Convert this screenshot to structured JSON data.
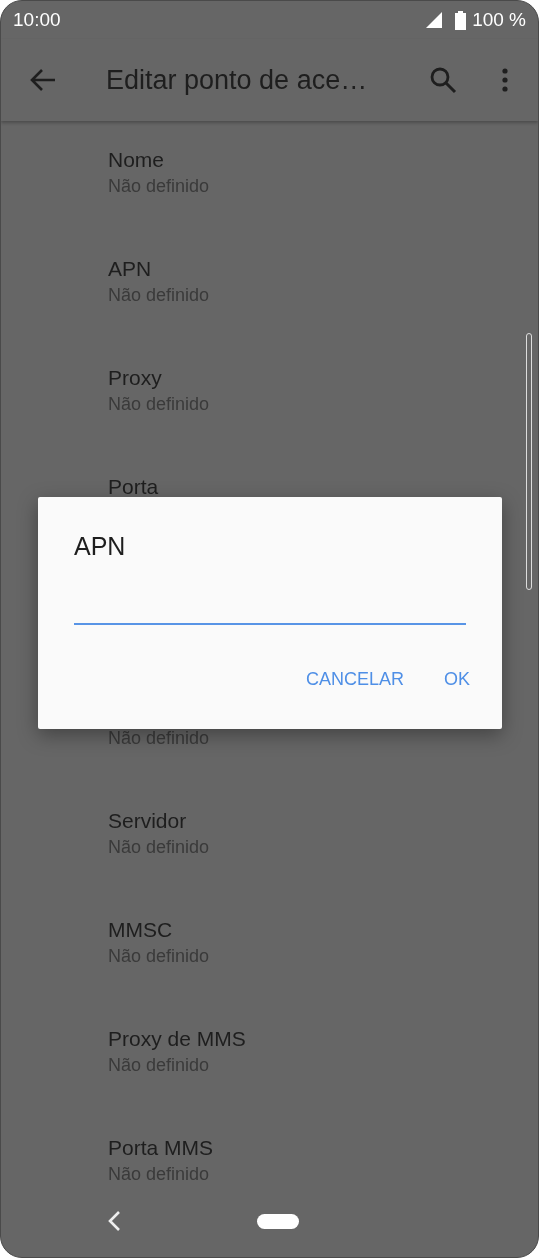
{
  "status_bar": {
    "time": "10:00",
    "battery": "100 %"
  },
  "toolbar": {
    "title": "Editar ponto de ace…"
  },
  "items_above": [
    {
      "title": "Nome",
      "subtitle": "Não definido"
    },
    {
      "title": "APN",
      "subtitle": "Não definido"
    },
    {
      "title": "Proxy",
      "subtitle": "Não definido"
    },
    {
      "title": "Porta"
    }
  ],
  "items_below": [
    {
      "subtitle": "Não definido"
    },
    {
      "title": "Servidor",
      "subtitle": "Não definido"
    },
    {
      "title": "MMSC",
      "subtitle": "Não definido"
    },
    {
      "title": "Proxy de MMS",
      "subtitle": "Não definido"
    },
    {
      "title": "Porta MMS",
      "subtitle": "Não definido"
    }
  ],
  "dialog": {
    "title": "APN",
    "buttons": [
      "CANCELAR",
      "OK"
    ]
  }
}
